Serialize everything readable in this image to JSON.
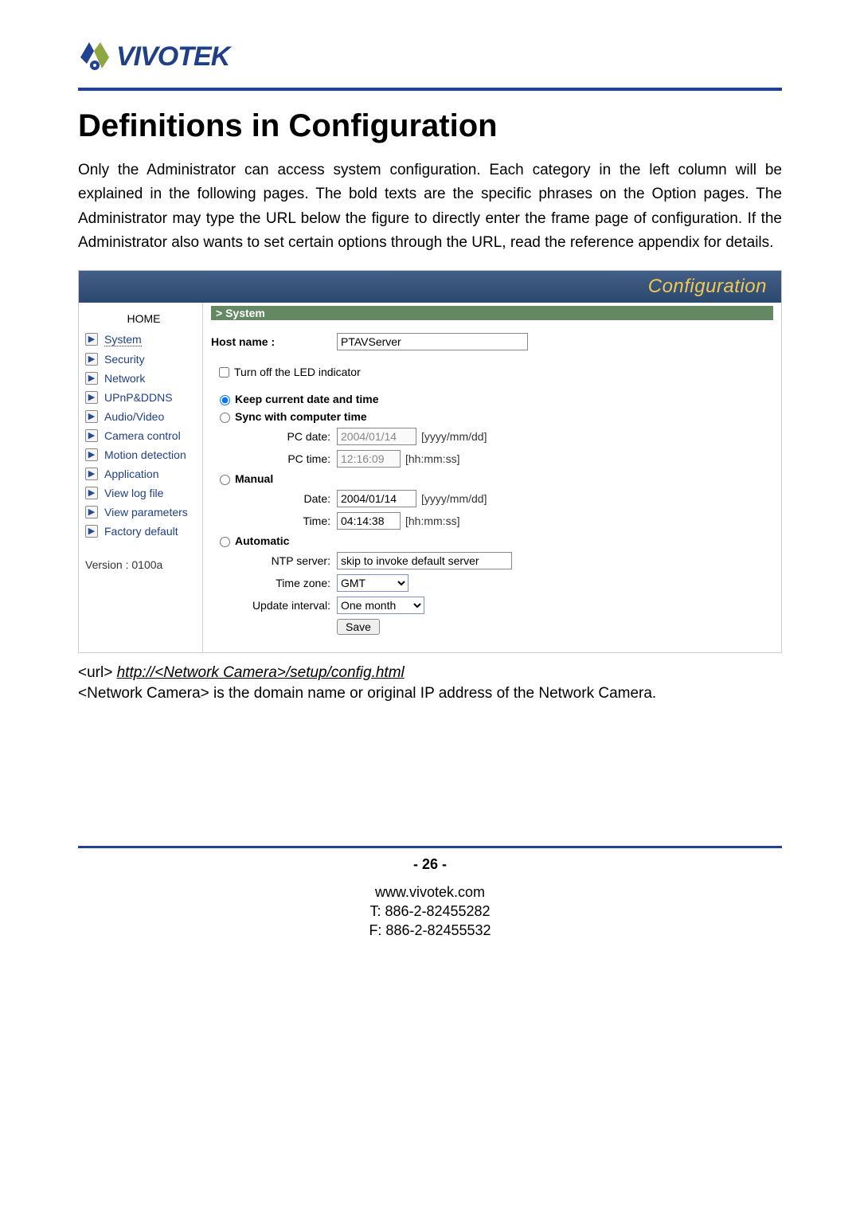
{
  "logo_text": "VIVOTEK",
  "title": "Definitions in Configuration",
  "intro": "Only the Administrator can access system configuration. Each category in the left column will be explained in the following pages. The bold texts are the specific phrases on the Option pages. The Administrator may type the URL below the figure to directly enter the frame page of configuration. If the Administrator also wants to set certain options through the URL, read the reference appendix for details.",
  "screenshot": {
    "bar_title": "Configuration",
    "home": "HOME",
    "nav": [
      "System",
      "Security",
      "Network",
      "UPnP&DDNS",
      "Audio/Video",
      "Camera control",
      "Motion detection",
      "Application",
      "View log file",
      "View parameters",
      "Factory default"
    ],
    "version": "Version : 0100a",
    "section": "> System",
    "hostname_label": "Host name :",
    "hostname_value": "PTAVServer",
    "led_label": "Turn off the LED indicator",
    "opt_keep": "Keep current date and time",
    "opt_sync": "Sync with computer time",
    "pc_date_label": "PC date:",
    "pc_date_value": "2004/01/14",
    "date_hint": "[yyyy/mm/dd]",
    "pc_time_label": "PC time:",
    "pc_time_value": "12:16:09",
    "time_hint": "[hh:mm:ss]",
    "opt_manual": "Manual",
    "m_date_label": "Date:",
    "m_date_value": "2004/01/14",
    "m_time_label": "Time:",
    "m_time_value": "04:14:38",
    "opt_auto": "Automatic",
    "ntp_label": "NTP server:",
    "ntp_value": "skip to invoke default server",
    "tz_label": "Time zone:",
    "tz_value": "GMT",
    "upd_label": "Update interval:",
    "upd_value": "One month",
    "save": "Save"
  },
  "url_label": "<url> ",
  "url_link": "http://<Network Camera>/setup/config.html",
  "url_subtext": "<Network Camera> is the domain name or original IP address of the Network Camera.",
  "page_number": "- 26 -",
  "footer1": "www.vivotek.com",
  "footer2": "T: 886-2-82455282",
  "footer3": "F: 886-2-82455532"
}
